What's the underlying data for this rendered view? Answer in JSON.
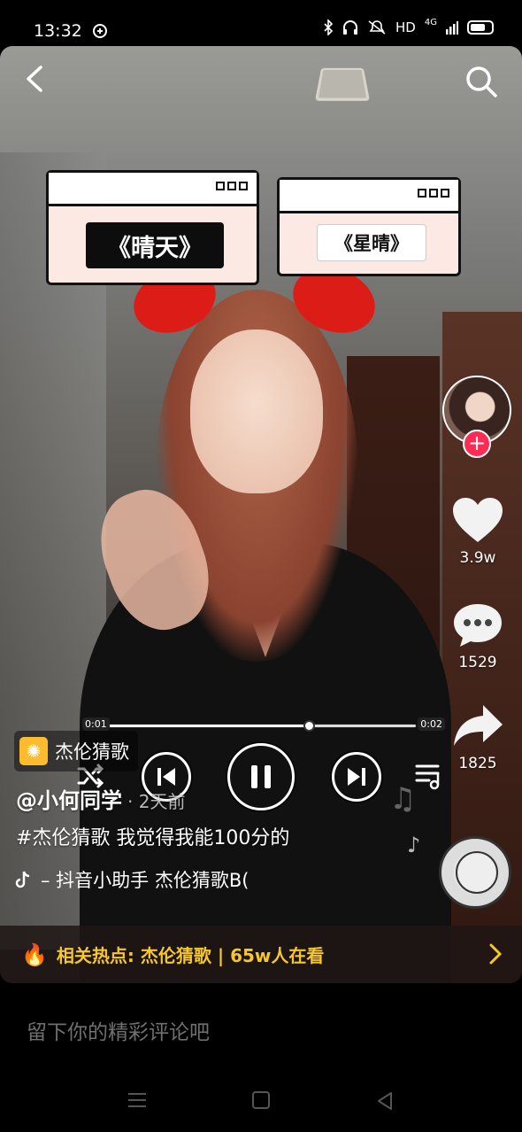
{
  "status": {
    "time": "13:32",
    "network": "HD",
    "signal": "4G"
  },
  "song_boxes": {
    "left_title": "《晴天》",
    "right_title": "《星晴》"
  },
  "player": {
    "elapsed": "0:01",
    "total": "0:02",
    "progress": 0.65
  },
  "actions": {
    "likes": "3.9w",
    "comments": "1529",
    "shares": "1825"
  },
  "info": {
    "tag": "杰伦猜歌",
    "author": "@小何同学",
    "time_ago": "· 2天前",
    "caption": "#杰伦猜歌 我觉得我能100分的",
    "music": "– 抖音小助手   杰伦猜歌B("
  },
  "hotbar": {
    "text": "相关热点: 杰伦猜歌 | 65w人在看"
  },
  "comment": {
    "placeholder": "留下你的精彩评论吧"
  },
  "colors": {
    "accent": "#fe2c55",
    "hot": "#f6c62a"
  },
  "icons": [
    "back-icon",
    "search-icon",
    "heart-icon",
    "comment-icon",
    "share-icon",
    "shuffle-icon",
    "prev-icon",
    "pause-icon",
    "next-icon",
    "playlist-icon",
    "music-note-icon",
    "fire-icon",
    "chevron-right-icon"
  ]
}
